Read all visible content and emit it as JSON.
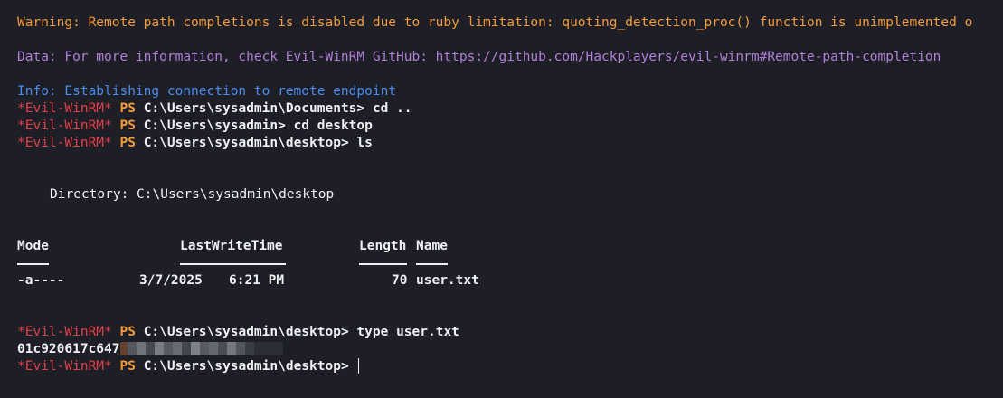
{
  "banner": {
    "warning": "Warning: Remote path completions is disabled due to ruby limitation: quoting_detection_proc() function is unimplemented o",
    "data": "Data: For more information, check Evil-WinRM GitHub: https://github.com/Hackplayers/evil-winrm#Remote-path-completion",
    "info": "Info: Establishing connection to remote endpoint"
  },
  "prompt": {
    "label": "*Evil-WinRM*",
    "ps": "PS"
  },
  "session": [
    {
      "path": "C:\\Users\\sysadmin\\Documents>",
      "command": "cd .."
    },
    {
      "path": "C:\\Users\\sysadmin>",
      "command": "cd desktop"
    },
    {
      "path": "C:\\Users\\sysadmin\\desktop>",
      "command": "ls"
    }
  ],
  "listing": {
    "directory_line": "Directory: C:\\Users\\sysadmin\\desktop",
    "headers": {
      "mode": "Mode",
      "lastwritetime": "LastWriteTime",
      "length": "Length",
      "name": "Name"
    },
    "rows": [
      {
        "mode": "-a----",
        "date": "3/7/2025",
        "time": "6:21 PM",
        "length": "70",
        "name": "user.txt"
      }
    ]
  },
  "type_command": {
    "path": "C:\\Users\\sysadmin\\desktop>",
    "command": "type user.txt"
  },
  "output": {
    "hash_visible": "01c920617c647"
  },
  "final_prompt": {
    "path": "C:\\Users\\sysadmin\\desktop>"
  },
  "colors": {
    "background": "#1d1e26",
    "warning": "#f29b3c",
    "data": "#b07fd6",
    "info": "#4a8cf0",
    "prompt_label": "#e0414a",
    "text": "#eef0f4"
  }
}
